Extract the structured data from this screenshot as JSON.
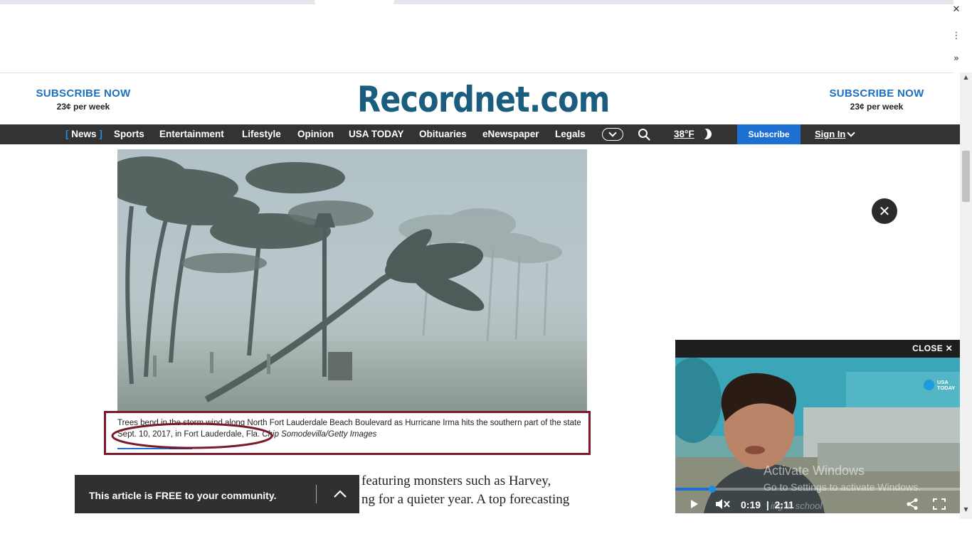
{
  "browser": {
    "close_glyph": "✕",
    "menu_glyph": "⋮",
    "expand_glyph": "»"
  },
  "masthead": {
    "logo": "Recordnet.com",
    "subscribe_left": {
      "title": "SUBSCRIBE NOW",
      "price": "23¢ per week"
    },
    "subscribe_right": {
      "title": "SUBSCRIBE NOW",
      "price": "23¢ per week"
    }
  },
  "nav": {
    "open_bracket": "[",
    "close_bracket": "]",
    "items": [
      "News",
      "Sports",
      "Entertainment",
      "Lifestyle",
      "Opinion",
      "USA TODAY",
      "Obituaries",
      "eNewspaper",
      "Legals"
    ],
    "weather": "38°F",
    "subscribe": "Subscribe",
    "sign_in": "Sign In"
  },
  "article": {
    "caption_line1": "Trees bend in the storm wind along North Fort Lauderdale Beach Boulevard as Hurricane Irma hits the southern part of the",
    "caption_line2": "state Sept. 10, 2017, in Fort Lauderdale, Fla.",
    "credit": "Chip Somodevilla/Getty Images",
    "body_line1": "featuring monsters such as Harvey,",
    "body_line2": "ng for a quieter year. A top forecasting"
  },
  "free_banner": {
    "text": "This article is FREE to your community."
  },
  "ad_close": "✕",
  "video": {
    "close_label": "CLOSE",
    "close_glyph": "✕",
    "brand_line1": "USA",
    "brand_line2": "TODAY",
    "current_time": "0:19",
    "separator": "|",
    "duration": "2:11",
    "progress": 0.13,
    "overlay_text": "ing in school"
  },
  "os_watermark": {
    "title": "Activate Windows",
    "subtitle": "Go to Settings to activate Windows."
  },
  "colors": {
    "accent_blue": "#1d6fc0",
    "logo_blue": "#1a5d7e",
    "nav_bg": "#333333",
    "highlight_red": "#7a1a2a"
  }
}
